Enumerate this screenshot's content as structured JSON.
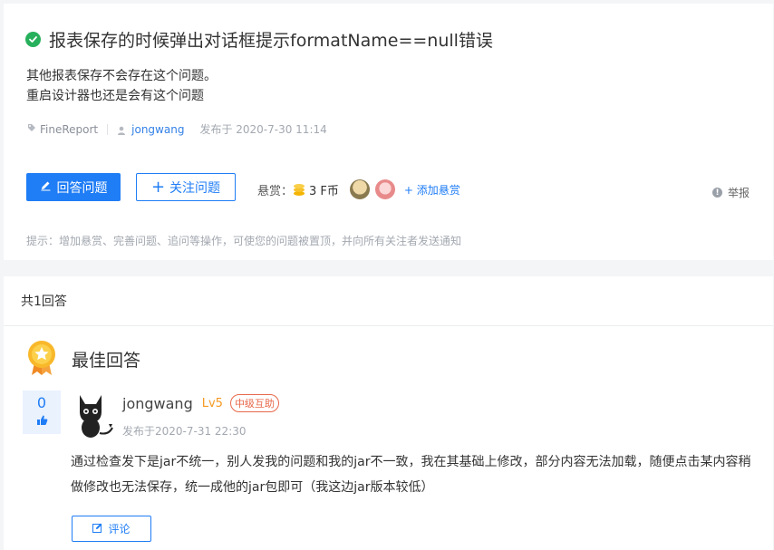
{
  "question": {
    "title": "报表保存的时候弹出对话框提示formatName==null错误",
    "body_lines": [
      "其他报表保存不会存在这个问题。",
      "重启设计器也还是会有这个问题"
    ],
    "tag": "FineReport",
    "author": "jongwang",
    "posted": "发布于 2020-7-30 11:14",
    "status_icon": "check-circle-icon"
  },
  "actions": {
    "answer_label": "回答问题",
    "follow_label": "关注问题",
    "bounty_label": "悬赏：",
    "bounty_amount": "3 F币",
    "add_bounty_label": "+ 添加悬赏",
    "report_label": "举报"
  },
  "hint": "提示：增加悬赏、完善问题、追问等操作，可使您的问题被置顶，并向所有关注者发送通知",
  "answers": {
    "count_label": "共1回答",
    "best_label": "最佳回答",
    "items": [
      {
        "votes": "0",
        "user": "jongwang",
        "level": "Lv5",
        "badge": "中级互助",
        "time": "发布于2020-7-31 22:30",
        "body": "通过检查发下是jar不统一，别人发我的问题和我的jar不一致，我在其基础上修改，部分内容无法加载，随便点击某内容稍做修改也无法保存，统一成他的jar包即可（我这边jar版本较低）",
        "comment_label": "评论"
      }
    ]
  },
  "colors": {
    "accent": "#1f7df5",
    "success": "#27b05c",
    "level": "#f59a23",
    "badge": "#e8684a"
  }
}
